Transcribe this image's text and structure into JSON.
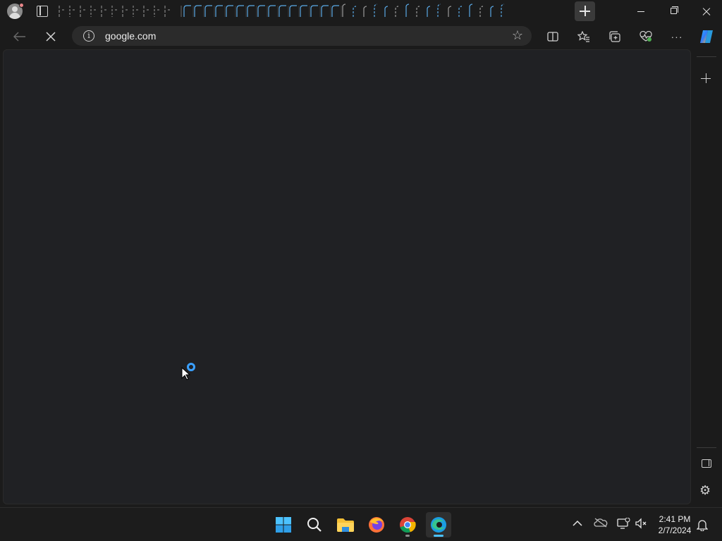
{
  "window": {
    "tab_strip_state": "many-collapsed-tabs",
    "new_tab_label": "+"
  },
  "toolbar": {
    "back_icon": "arrow-left-icon",
    "stop_icon": "close-icon",
    "address": {
      "url": "google.com",
      "info_icon": "i"
    },
    "favorite_icon": "star-icon",
    "split_screen_icon": "split-screen-icon",
    "favorites_icon": "favorites-icon",
    "collections_icon": "collections-icon",
    "performance_icon": "heartbeat-icon",
    "more_label": "···"
  },
  "page": {
    "loading": true
  },
  "taskbar": {
    "apps": [
      "start",
      "search",
      "file-explorer",
      "firefox",
      "chrome",
      "edge"
    ],
    "clock": {
      "time": "2:41 PM",
      "date": "2/7/2024"
    }
  },
  "colors": {
    "background": "#1b1b1b",
    "content": "#202124",
    "accent": "#4cc2ff",
    "spinner": "#3aa0ff"
  }
}
